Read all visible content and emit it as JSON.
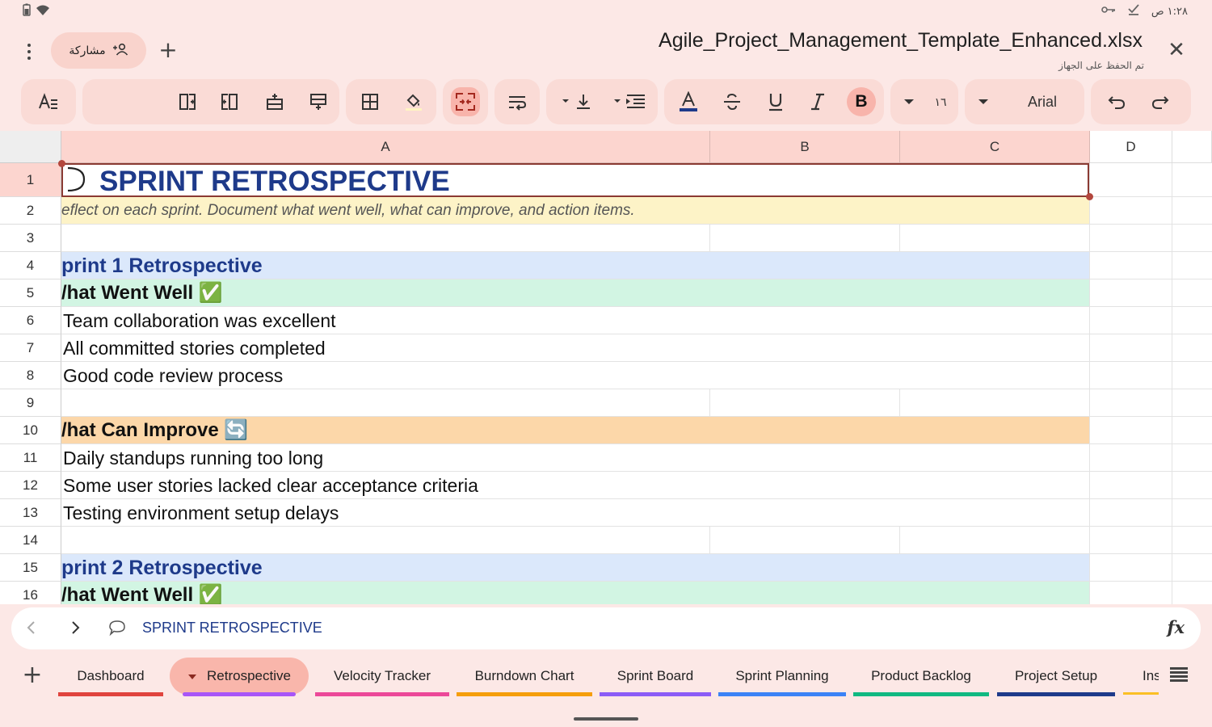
{
  "status": {
    "time": "١:٢٨ ص"
  },
  "header": {
    "share_label": "مشاركة",
    "doc_title": "Agile_Project_Management_Template_Enhanced.xlsx",
    "saved_status": "تم الحفظ على الجهاز"
  },
  "toolbar": {
    "font_size": "١٦",
    "font_name": "Arial",
    "bold_label": "B",
    "italic_label": "I",
    "underline_label": "U",
    "textcolor_label": "A"
  },
  "grid": {
    "columns": [
      "A",
      "B",
      "C",
      "D"
    ],
    "rows": [
      {
        "n": "1",
        "text": " SPRINT RETROSPECTIVE",
        "style": "title",
        "bg": "#ffffff"
      },
      {
        "n": "2",
        "text": "eflect on each sprint. Document what went well, what can improve, and action items.",
        "style": "sub",
        "bg": "#fdf3c7"
      },
      {
        "n": "3",
        "text": "",
        "style": "empty",
        "bg": "#ffffff"
      },
      {
        "n": "4",
        "text": "print 1 Retrospective",
        "style": "sprint",
        "bg": "#dbe8fb"
      },
      {
        "n": "5",
        "text": "/hat Went Well ✅",
        "style": "section",
        "bg": "#d2f5e3"
      },
      {
        "n": "6",
        "text": "Team collaboration was excellent",
        "style": "item",
        "bg": "#ffffff"
      },
      {
        "n": "7",
        "text": "All committed stories completed",
        "style": "item",
        "bg": "#ffffff"
      },
      {
        "n": "8",
        "text": "Good code review process",
        "style": "item",
        "bg": "#ffffff"
      },
      {
        "n": "9",
        "text": "",
        "style": "empty",
        "bg": "#ffffff"
      },
      {
        "n": "10",
        "text": "/hat Can Improve 🔄",
        "style": "section",
        "bg": "#fcd7a9"
      },
      {
        "n": "11",
        "text": "Daily standups running too long",
        "style": "item",
        "bg": "#ffffff"
      },
      {
        "n": "12",
        "text": "Some user stories lacked clear acceptance criteria",
        "style": "item",
        "bg": "#ffffff"
      },
      {
        "n": "13",
        "text": "Testing environment setup delays",
        "style": "item",
        "bg": "#ffffff"
      },
      {
        "n": "14",
        "text": "",
        "style": "empty",
        "bg": "#ffffff"
      },
      {
        "n": "15",
        "text": "print 2 Retrospective",
        "style": "sprint",
        "bg": "#dbe8fb"
      },
      {
        "n": "16",
        "text": "/hat Went Well ✅",
        "style": "section",
        "bg": "#d2f5e3"
      }
    ]
  },
  "formula_bar": {
    "content": "SPRINT RETROSPECTIVE",
    "fx_label": "fx"
  },
  "sheet_tabs": [
    {
      "label": "Dashboard",
      "color": "#e0443e",
      "active": false
    },
    {
      "label": "Retrospective",
      "color": "#a855f7",
      "active": true
    },
    {
      "label": "Velocity Tracker",
      "color": "#ec4899",
      "active": false
    },
    {
      "label": "Burndown Chart",
      "color": "#f59e0b",
      "active": false
    },
    {
      "label": "Sprint Board",
      "color": "#8b5cf6",
      "active": false
    },
    {
      "label": "Sprint Planning",
      "color": "#3b82f6",
      "active": false
    },
    {
      "label": "Product Backlog",
      "color": "#10b981",
      "active": false
    },
    {
      "label": "Project Setup",
      "color": "#1e3a8a",
      "active": false
    },
    {
      "label": "Ins",
      "color": "#fbbf24",
      "active": false
    }
  ]
}
